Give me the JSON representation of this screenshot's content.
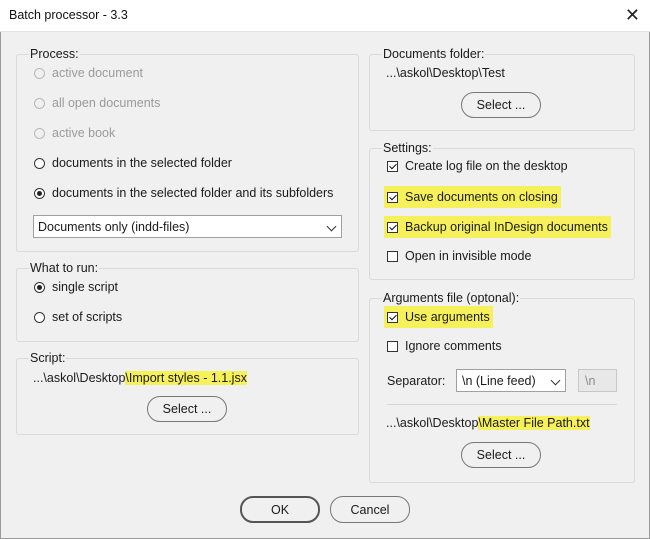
{
  "window": {
    "title": "Batch processor - 3.3",
    "close_glyph": "✕"
  },
  "process": {
    "title": "Process:",
    "options": [
      {
        "label": "active document",
        "enabled": false,
        "checked": false
      },
      {
        "label": "all open documents",
        "enabled": false,
        "checked": false
      },
      {
        "label": "active book",
        "enabled": false,
        "checked": false
      },
      {
        "label": "documents in the selected folder",
        "enabled": true,
        "checked": false
      },
      {
        "label": "documents in the selected folder and its subfolders",
        "enabled": true,
        "checked": true
      }
    ],
    "filter_selected": "Documents only (indd-files)"
  },
  "what_to_run": {
    "title": "What to run:",
    "options": [
      {
        "label": "single script",
        "checked": true
      },
      {
        "label": "set of scripts",
        "checked": false
      }
    ]
  },
  "script": {
    "title": "Script:",
    "path_prefix": "...\\askol\\Desktop",
    "path_file": "\\Import styles - 1.1.jsx",
    "select_label": "Select ..."
  },
  "documents_folder": {
    "title": "Documents folder:",
    "path": "...\\askol\\Desktop\\Test",
    "select_label": "Select ..."
  },
  "settings": {
    "title": "Settings:",
    "options": [
      {
        "label": "Create log file on the desktop",
        "checked": true,
        "highlighted": false
      },
      {
        "label": "Save documents on closing",
        "checked": true,
        "highlighted": true
      },
      {
        "label": "Backup original InDesign documents",
        "checked": true,
        "highlighted": true
      },
      {
        "label": "Open in invisible mode",
        "checked": false,
        "highlighted": false
      }
    ]
  },
  "arguments": {
    "title": "Arguments file (optonal):",
    "use_arguments": {
      "label": "Use arguments",
      "checked": true
    },
    "ignore_comments": {
      "label": "Ignore comments",
      "checked": false
    },
    "separator_label": "Separator:",
    "separator_selected": "\\n (Line feed)",
    "separator_value": "\\n",
    "path_prefix": "...\\askol\\Desktop",
    "path_file": "\\Master File Path.txt",
    "select_label": "Select ..."
  },
  "footer": {
    "ok_label": "OK",
    "cancel_label": "Cancel"
  },
  "colors": {
    "highlight": "#f6f05a",
    "background": "#f0f0f0"
  }
}
